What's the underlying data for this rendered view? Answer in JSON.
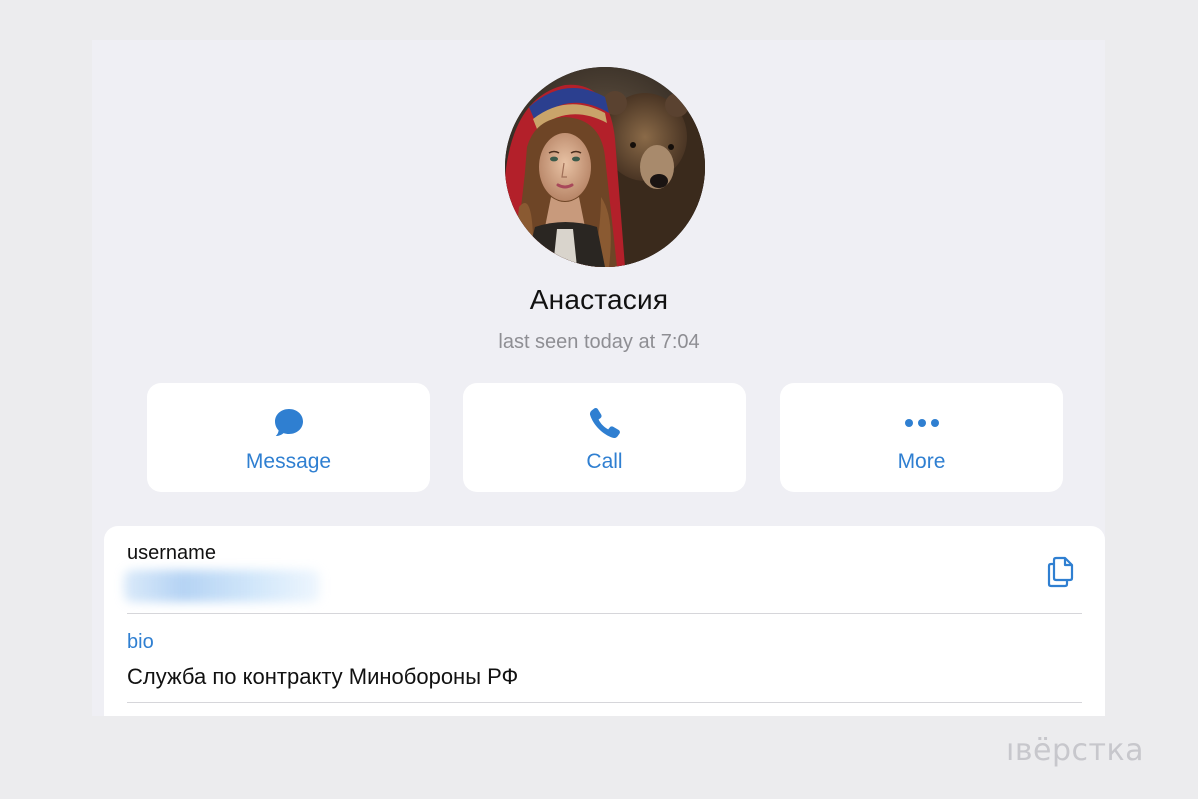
{
  "profile": {
    "name": "Анастасия",
    "status": "last seen today at 7:04",
    "avatar_icon": "profile-photo"
  },
  "actions": [
    {
      "label": "Message",
      "icon": "chat-bubble-icon"
    },
    {
      "label": "Call",
      "icon": "phone-icon"
    },
    {
      "label": "More",
      "icon": "ellipsis-icon"
    }
  ],
  "info": {
    "username_label": "username",
    "username_value": "",
    "copy_icon": "copy-icon",
    "bio_label": "bio",
    "bio_text": "Служба по контракту Минобороны РФ"
  },
  "watermark": "ıвёрстка",
  "colors": {
    "accent": "#2f7fd1",
    "background": "#efeff4",
    "card": "#ffffff",
    "secondary_text": "#8e8e93"
  }
}
